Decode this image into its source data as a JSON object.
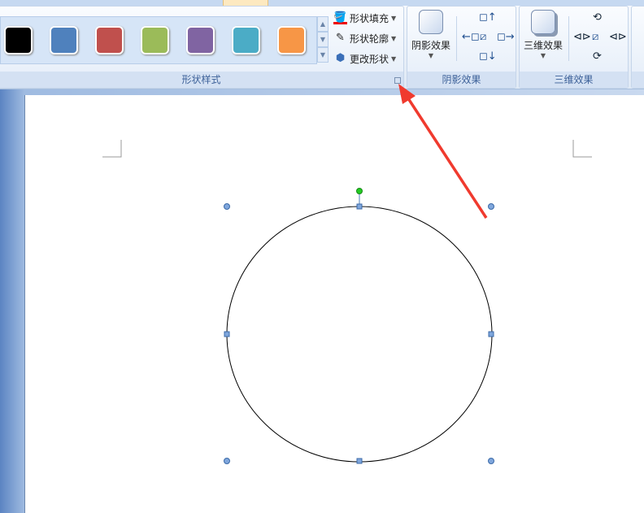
{
  "ribbon": {
    "shape_styles": {
      "label": "形状样式",
      "swatches": [
        "#000000",
        "#4f81bd",
        "#c0504d",
        "#9bbb59",
        "#8064a2",
        "#4bacc6",
        "#f79646"
      ],
      "fill_label": "形状填充",
      "outline_label": "形状轮廓",
      "change_shape_label": "更改形状"
    },
    "shadow": {
      "label": "阴影效果",
      "button_label": "阴影效果"
    },
    "threed": {
      "label": "三维效果",
      "button_label": "三维效果"
    }
  },
  "colors": {
    "arrow": "#f03a2e",
    "handle": "#4f81bd",
    "rotate_handle": "#22cc22"
  }
}
